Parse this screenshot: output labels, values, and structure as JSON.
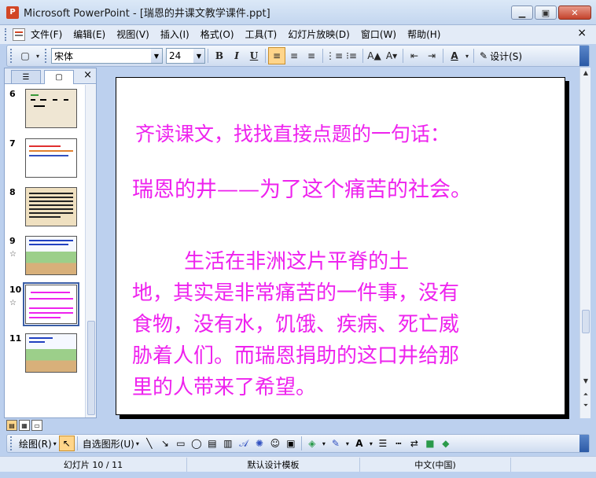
{
  "window": {
    "icon_label": "P",
    "title": "Microsoft PowerPoint - [瑞恩的井课文教学课件.ppt]",
    "minimize": "▁",
    "restore": "▣",
    "close": "✕"
  },
  "menu": {
    "items": [
      "文件(F)",
      "编辑(E)",
      "视图(V)",
      "插入(I)",
      "格式(O)",
      "工具(T)",
      "幻灯片放映(D)",
      "窗口(W)",
      "帮助(H)"
    ],
    "close": "×"
  },
  "toolbar": {
    "font_name": "宋体",
    "font_size": "24",
    "bold": "B",
    "italic": "I",
    "underline": "U",
    "design_label": "设计(S)"
  },
  "pane": {
    "close": "×",
    "thumbnails": [
      {
        "num": "6",
        "star": ""
      },
      {
        "num": "7",
        "star": ""
      },
      {
        "num": "8",
        "star": ""
      },
      {
        "num": "9",
        "star": "☆"
      },
      {
        "num": "10",
        "star": "☆"
      },
      {
        "num": "11",
        "star": ""
      }
    ]
  },
  "slide": {
    "line1": "齐读课文，找找直接点题的一句话：",
    "line2": "瑞恩的井——为了这个痛苦的社会。",
    "paragraph": "        生活在非洲这片平脊的土\n地，其实是非常痛苦的一件事，没有\n食物，没有水，饥饿、疾病、死亡威\n胁着人们。而瑞恩捐助的这口井给那\n里的人带来了希望。"
  },
  "drawbar": {
    "draw_label": "绘图(R)",
    "autoshapes_label": "自选图形(U)"
  },
  "status": {
    "slide_info": "幻灯片 10 / 11",
    "template": "默认设计模板",
    "language": "中文(中国)"
  },
  "colors": {
    "slide_text": "#ee22ee",
    "selected_thumb": "#3b5ea6"
  }
}
